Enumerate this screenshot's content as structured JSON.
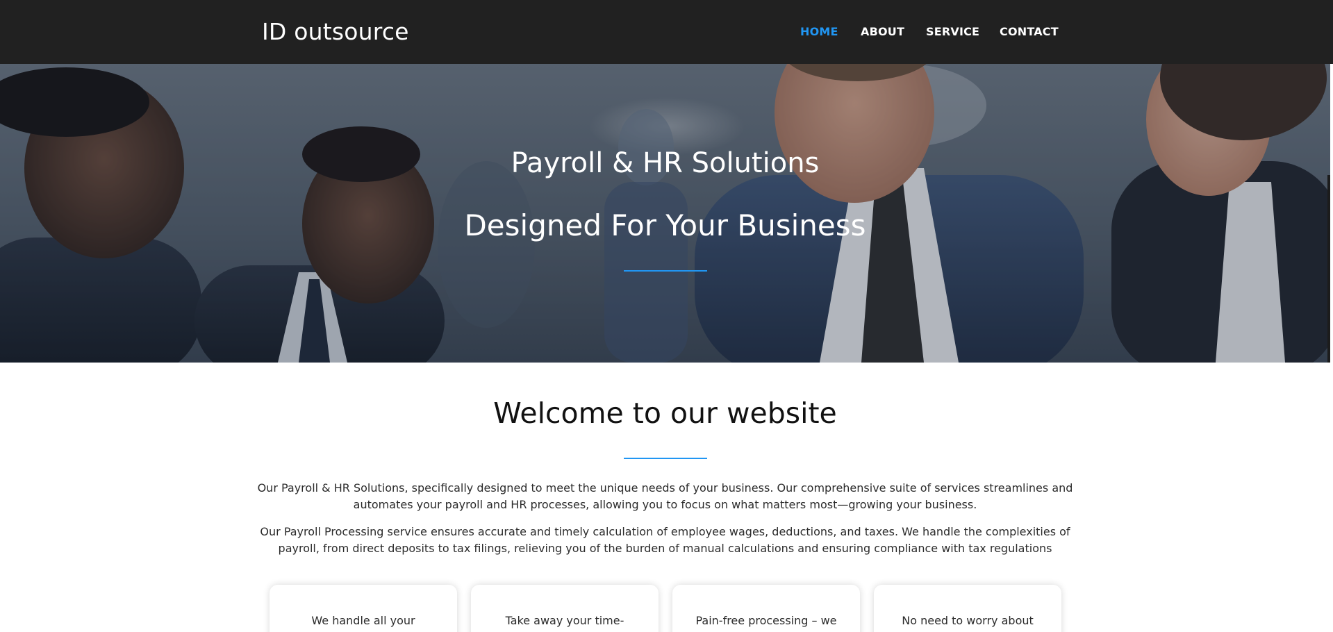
{
  "nav": {
    "brand": "ID outsource",
    "links": [
      {
        "label": "HOME",
        "active": true
      },
      {
        "label": "ABOUT",
        "active": false
      },
      {
        "label": "SERVICE",
        "active": false
      },
      {
        "label": "CONTACT",
        "active": false
      }
    ]
  },
  "hero": {
    "title_line1": "Payroll & HR Solutions",
    "title_line2": "Designed For Your Business"
  },
  "welcome": {
    "title": "Welcome to our website",
    "paragraph1": "Our Payroll & HR Solutions, specifically designed to meet the unique needs of your business. Our comprehensive suite of services streamlines and automates your payroll and HR processes, allowing you to focus on what matters most—growing your business.",
    "paragraph2": "Our Payroll Processing service ensures accurate and timely calculation of employee wages, deductions, and taxes. We handle the complexities of payroll, from direct deposits to tax filings, relieving you of the burden of manual calculations and ensuring compliance with tax regulations"
  },
  "cards": [
    {
      "text": "We handle all your"
    },
    {
      "text": "Take away your time-"
    },
    {
      "text": "Pain-free processing – we"
    },
    {
      "text": "No need to worry about"
    }
  ],
  "colors": {
    "navbar_bg": "#212121",
    "accent": "#2196f3",
    "text_dark": "#111111"
  }
}
